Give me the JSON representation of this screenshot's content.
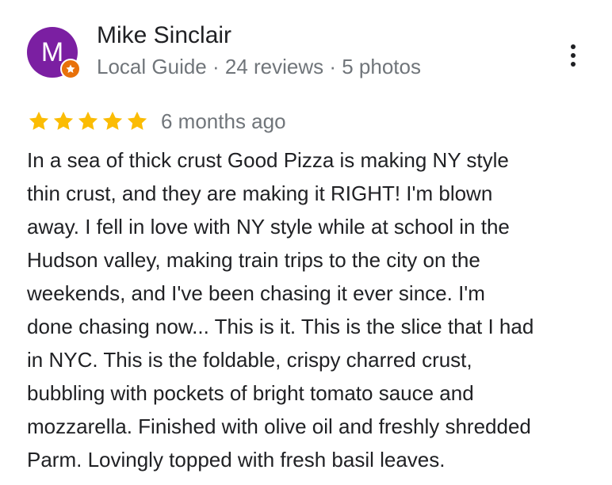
{
  "reviewer": {
    "initial": "M",
    "name": "Mike Sinclair",
    "meta": "Local Guide · 24 reviews · 5 photos",
    "avatar_color": "#7b1fa2",
    "badge_color": "#e8710a",
    "badge_icon": "local-guide-star-icon"
  },
  "menu": {
    "icon": "more-vert-icon"
  },
  "rating": {
    "value": 5,
    "max": 5,
    "star_color": "#fbbc04",
    "date": "6 months ago"
  },
  "review": {
    "lines": [
      "In a sea of thick crust Good Pizza is making NY style",
      "thin crust, and they are making it RIGHT! I'm blown",
      "away. I fell in love with NY style while at school in the",
      "Hudson valley, making train trips to the city on the",
      "weekends, and I've been chasing it ever since. I'm",
      "done chasing now... This is it. This is the slice that I had",
      "in NYC. This is the foldable, crispy charred crust,",
      "bubbling with pockets of bright tomato sauce and",
      "mozzarella. Finished with olive oil and freshly shredded",
      "Parm. Lovingly topped with fresh basil leaves."
    ]
  }
}
